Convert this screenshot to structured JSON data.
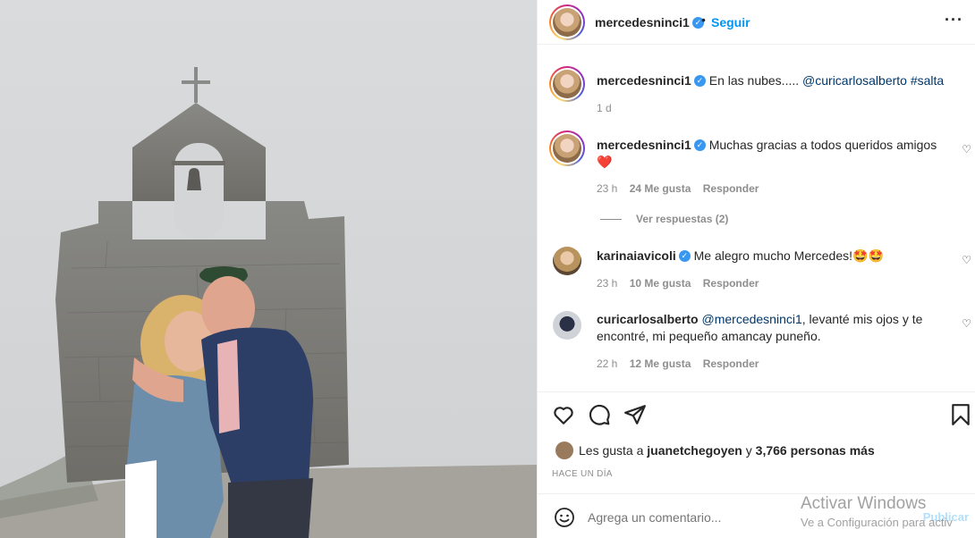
{
  "post": {
    "photo_description_icon": "photo-church-couple",
    "author": "mercedesninci1",
    "follow_label": "Seguir",
    "more_icon": "more-icon"
  },
  "caption": {
    "user": "mercedesninci1",
    "text": "En las nubes.....",
    "mention": "@curicarlosalberto",
    "hashtag": "#salta",
    "time": "1 d"
  },
  "comments": [
    {
      "user": "mercedesninci1",
      "text": "Muchas gracias a todos queridos amigos",
      "emoji": "❤️",
      "time": "23 h",
      "likes": "24 Me gusta",
      "reply": "Responder",
      "view_replies": "Ver respuestas (2)"
    },
    {
      "user": "karinaiavicoli",
      "text": "Me alegro mucho Mercedes!🤩🤩",
      "time": "23 h",
      "likes": "10 Me gusta",
      "reply": "Responder"
    },
    {
      "user": "curicarlosalberto",
      "mention": "@mercedesninci1",
      "text": ", levanté mis ojos y te encontré, mi pequeño amancay puneño.",
      "time": "22 h",
      "likes": "12 Me gusta",
      "reply": "Responder"
    }
  ],
  "likes": {
    "prefix": "Les gusta a",
    "user": "juanetchegoyen",
    "connector": "y",
    "count": "3,766 personas más"
  },
  "posted_time": "HACE UN DÍA",
  "add_comment": {
    "placeholder": "Agrega un comentario...",
    "publish": "Publicar"
  },
  "watermark": {
    "line1": "Activar Windows",
    "line2": "Ve a Configuración para activ"
  },
  "colors": {
    "link": "#0095f6",
    "verified": "#3897f0",
    "heart": "#ed4956",
    "muted": "#8e8e8e"
  }
}
